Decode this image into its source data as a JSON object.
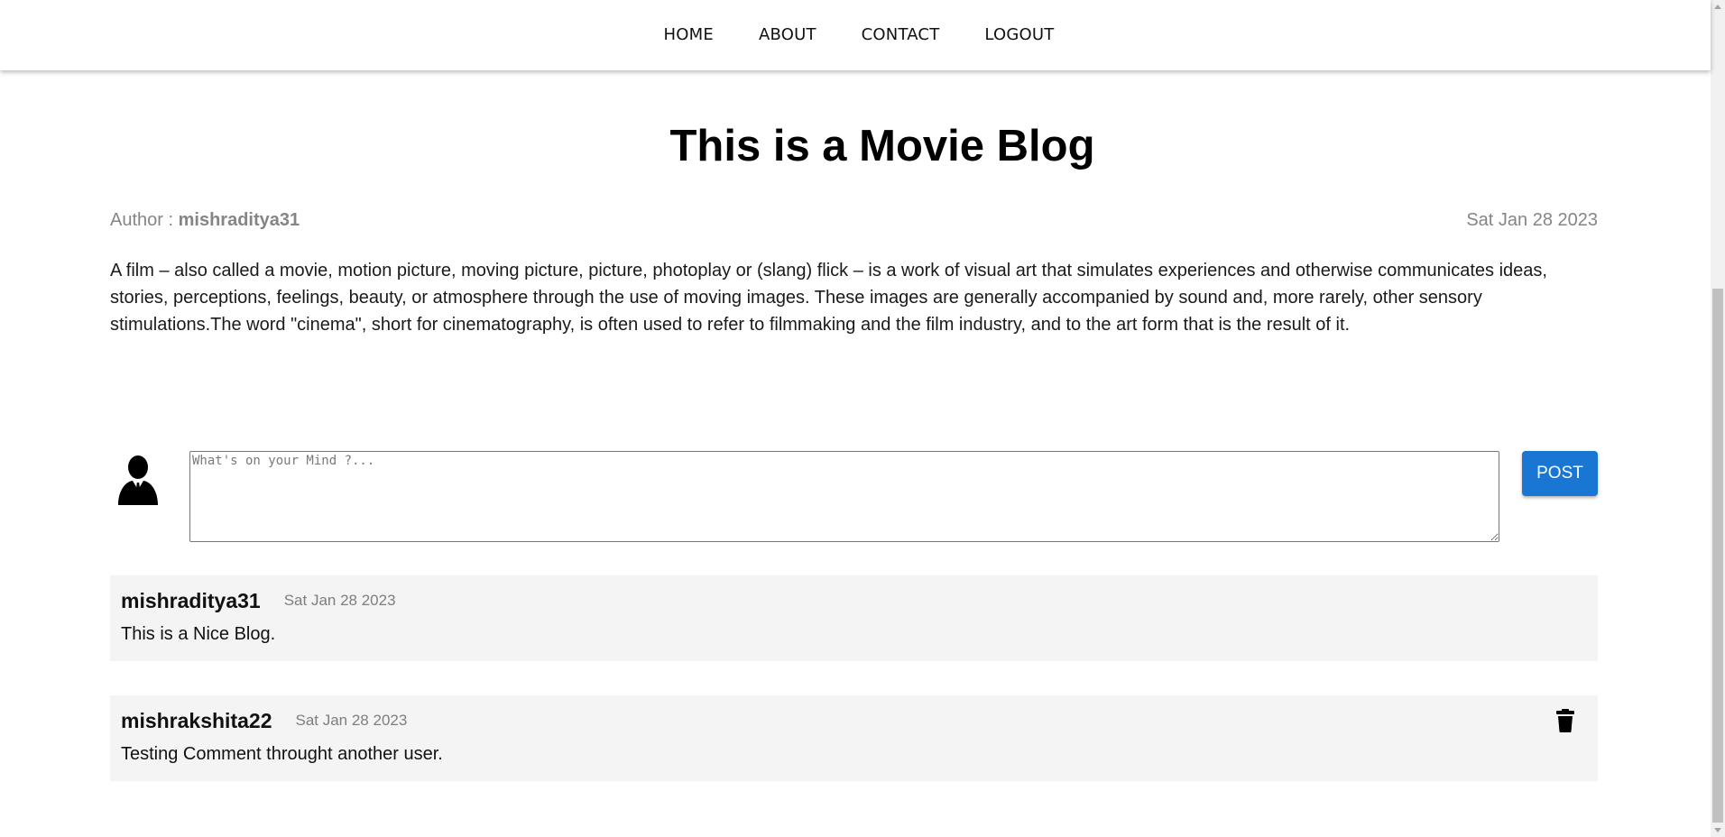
{
  "nav": {
    "items": [
      {
        "label": "HOME"
      },
      {
        "label": "ABOUT"
      },
      {
        "label": "CONTACT"
      },
      {
        "label": "LOGOUT"
      }
    ]
  },
  "blog": {
    "title": "This is a Movie Blog",
    "author_prefix": "Author : ",
    "author": "mishraditya31",
    "date": "Sat Jan 28 2023",
    "description": "A film – also called a movie, motion picture, moving picture, picture, photoplay or (slang) flick – is a work of visual art that simulates experiences and otherwise communicates ideas, stories, perceptions, feelings, beauty, or atmosphere through the use of moving images. These images are generally accompanied by sound and, more rarely, other sensory stimulations.The word \"cinema\", short for cinematography, is often used to refer to filmmaking and the film industry, and to the art form that is the result of it."
  },
  "comment_form": {
    "placeholder": "What's on your Mind ?...",
    "value": "",
    "post_label": "POST",
    "avatar_icon": "user-avatar-icon"
  },
  "comments": [
    {
      "user": "mishraditya31",
      "date": "Sat Jan 28 2023",
      "text": "This is a Nice Blog.",
      "has_delete": false
    },
    {
      "user": "mishrakshita22",
      "date": "Sat Jan 28 2023",
      "text": "Testing Comment throught another user.",
      "has_delete": true,
      "delete_icon": "trash-icon"
    }
  ],
  "colors": {
    "post_button": "#1976d2",
    "comment_background": "#f4f4f4",
    "meta_text": "#858585"
  }
}
